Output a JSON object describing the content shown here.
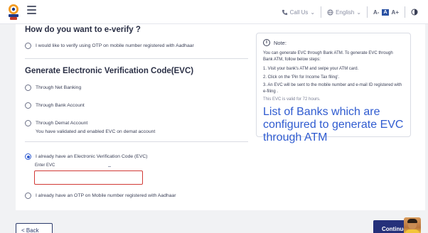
{
  "header": {
    "logo_icon": "emblem-icon",
    "menu_icon": "hamburger-icon",
    "call_us": "Call Us",
    "language": "English",
    "font_controls": [
      "A-",
      "A",
      "A+"
    ]
  },
  "verify": {
    "heading": "How do you want to e-verify ?",
    "aadhaar_otp_option": "I would like to verify using OTP on mobile number registered with Aadhaar"
  },
  "evc": {
    "heading": "Generate Electronic Verification Code(EVC)",
    "options": [
      "Through Net Banking",
      "Through Bank Account",
      "Through Demat Account"
    ],
    "demat_subtext": "You have validated and enabled EVC on demat account"
  },
  "existing": {
    "evc_option": "I already have an Electronic Verification Code (EVC)",
    "evc_label": "Enter EVC",
    "evc_value": "",
    "otp_option": "I already have an OTP on Mobile number registered with Aadhaar"
  },
  "note": {
    "title": "Note:",
    "intro": "You can generate EVC through Bank ATM. To generate EVC through Bank ATM, follow below steps:",
    "steps": [
      "1. Visit your bank's ATM and swipe your ATM card.",
      "2. Click on the 'Pin for Income Tax filing'.",
      "3. An EVC will be sent to the mobile number and e-mail ID registered with e-filing ."
    ],
    "validity": "This EVC is valid for 72 hours.",
    "link": "List of Banks which are configured to generate EVC through ATM"
  },
  "footer": {
    "back": "< Back",
    "continue": "Continue"
  },
  "colors": {
    "accent": "#2f5bd0",
    "primary_button": "#25307a",
    "error_border": "#d23a36"
  }
}
